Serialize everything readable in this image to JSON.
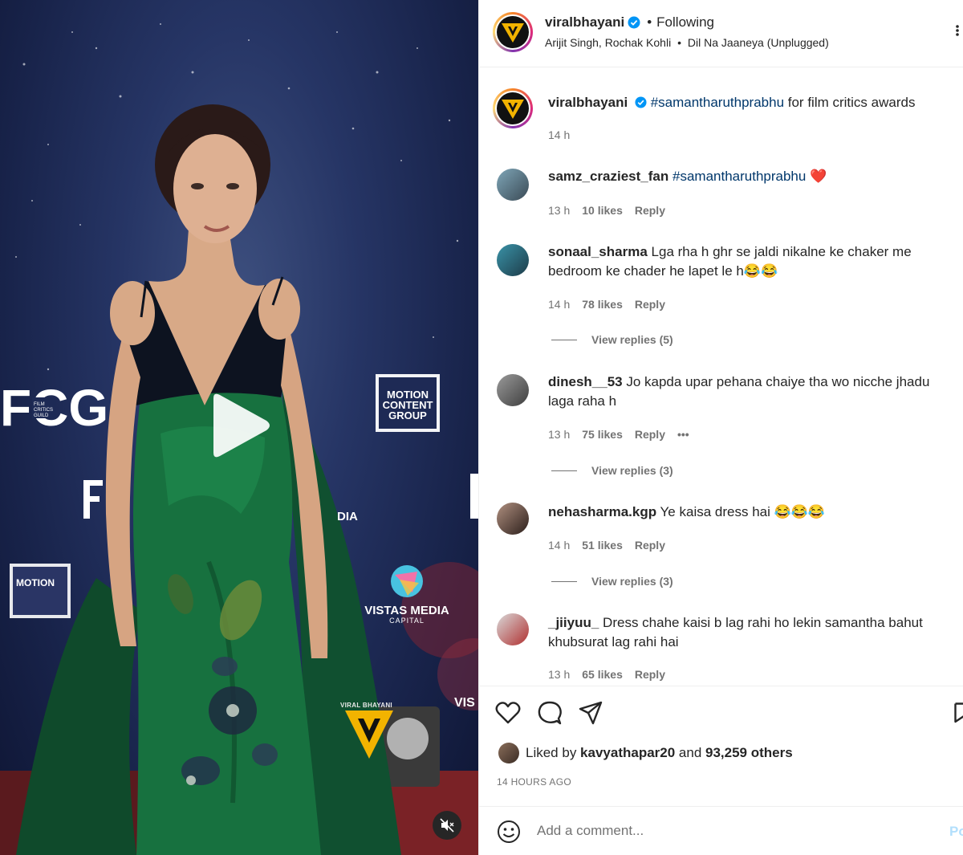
{
  "video": {
    "backdrop_texts": {
      "fcg": "FCG",
      "fcg_small": "FILM CRITICS GUILD",
      "motion": "MOTION CONTENT GROUP",
      "motion_left": "MOTION",
      "vistas": "VISTAS MEDIA",
      "vistas_sub": "CAPITAL",
      "dia": "DIA",
      "vis": "VIS"
    },
    "watermark": "VIRAL BHAYANI",
    "play_icon": "play-icon",
    "mute_icon": "muted-speaker-icon"
  },
  "header": {
    "username": "viralbhayani",
    "separator": "•",
    "follow_status": "Following",
    "audio_artists": "Arijit Singh, Rochak Kohli",
    "audio_sep": "•",
    "audio_track": "Dil Na Jaaneya (Unplugged)",
    "more_icon": "more-options-icon"
  },
  "caption": {
    "username": "viralbhayani",
    "hashtag": "#samantharuthprabhu",
    "text": " for film critics awards",
    "time": "14 h"
  },
  "comments": [
    {
      "username": "samz_craziest_fan",
      "text": "",
      "hashtag": "#samantharuthprabhu",
      "emoji": "❤️",
      "time": "13 h",
      "likes": "10 likes",
      "reply": "Reply"
    },
    {
      "username": "sonaal_sharma",
      "text": "Lga rha h ghr se jaldi nikalne ke chaker me bedroom ke chader he lapet le h😂😂",
      "time": "14 h",
      "likes": "78 likes",
      "reply": "Reply",
      "view_replies": "View replies (5)"
    },
    {
      "username": "dinesh__53",
      "text": "Jo kapda upar pehana chaiye tha wo nicche jhadu laga raha h",
      "time": "13 h",
      "likes": "75 likes",
      "reply": "Reply",
      "more": "•••",
      "view_replies": "View replies (3)"
    },
    {
      "username": "nehasharma.kgp",
      "text": "Ye kaisa dress hai 😂😂😂",
      "time": "14 h",
      "likes": "51 likes",
      "reply": "Reply",
      "view_replies": "View replies (3)"
    },
    {
      "username": "_jiiyuu_",
      "text": "Dress chahe kaisi b lag rahi ho lekin samantha bahut khubsurat lag rahi hai",
      "time": "13 h",
      "likes": "65 likes",
      "reply": "Reply"
    }
  ],
  "actions": {
    "like_icon": "heart-icon",
    "comment_icon": "comment-icon",
    "share_icon": "share-icon",
    "save_icon": "bookmark-icon",
    "liked_by_prefix": "Liked by ",
    "liked_by_user": "kavyathapar20",
    "liked_by_mid": " and ",
    "liked_by_others": "93,259 others",
    "time_ago": "14 HOURS AGO"
  },
  "add_comment": {
    "placeholder": "Add a comment...",
    "emoji_icon": "smiley-icon",
    "post_label": "Post"
  },
  "colors": {
    "verified": "#0095f6",
    "hashtag": "#00376b",
    "heart": "#ed4956",
    "post_disabled": "#b2dffc"
  }
}
